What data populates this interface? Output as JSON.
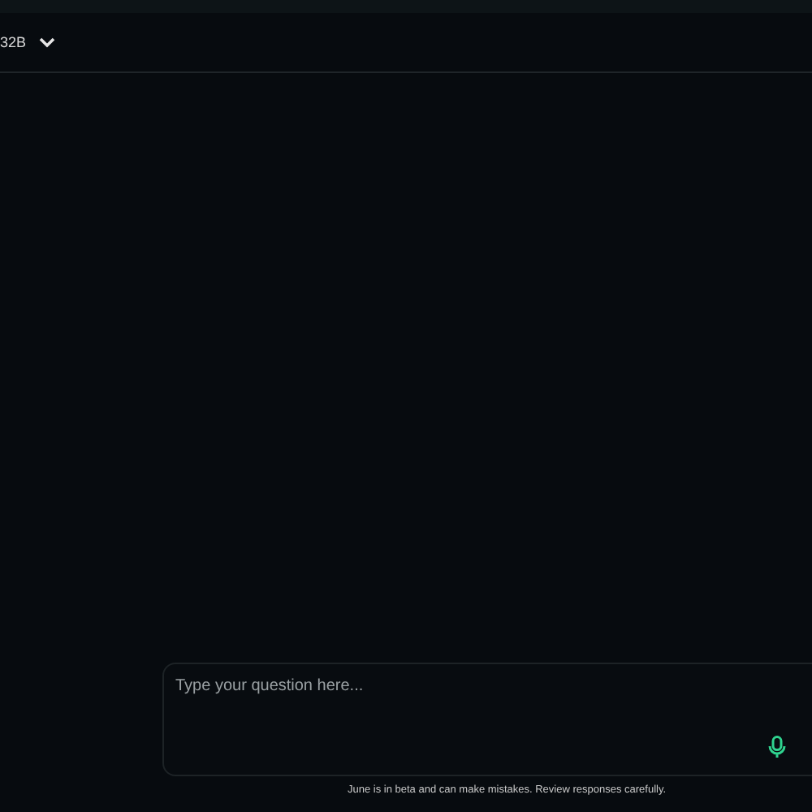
{
  "header": {
    "model": "32B"
  },
  "composer": {
    "placeholder": "Type your question here..."
  },
  "disclaimer": "June is in beta and can make mistakes. Review responses carefully."
}
